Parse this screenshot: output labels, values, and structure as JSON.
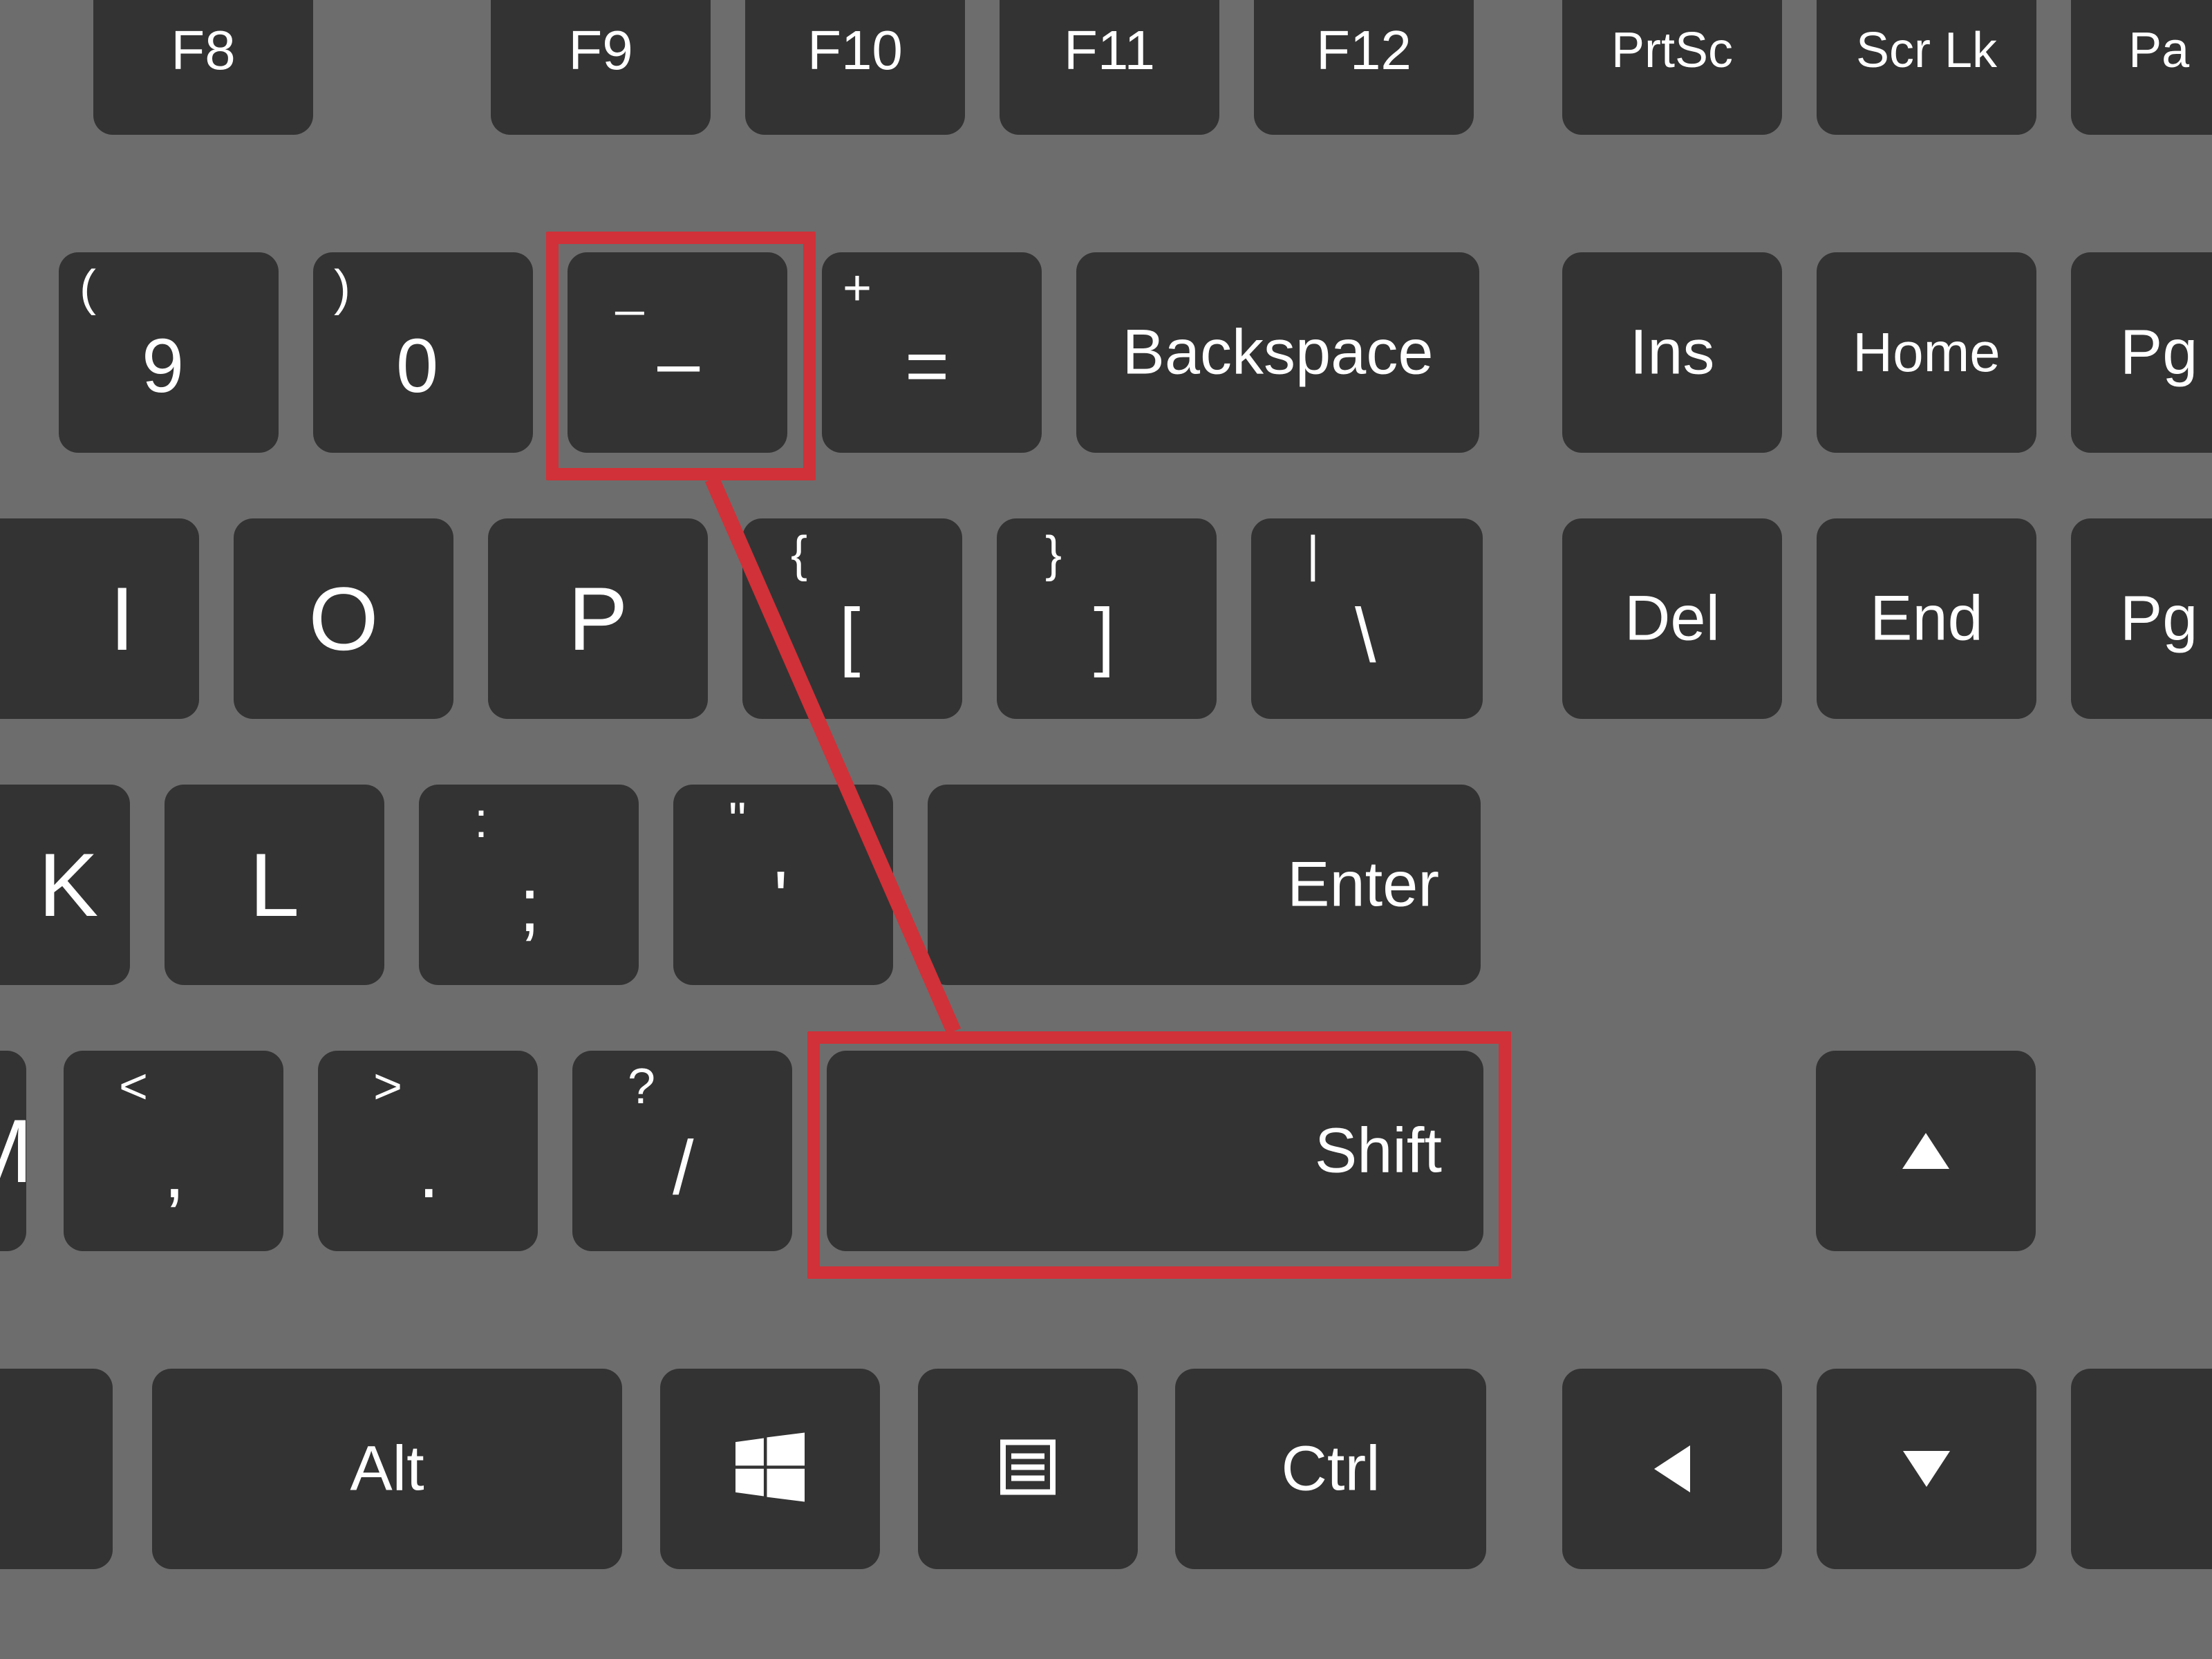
{
  "colors": {
    "background": "#6d6d6d",
    "key": "#333333",
    "key_text": "#ffffff",
    "highlight": "#d13138"
  },
  "rows": {
    "function": [
      {
        "id": "f8",
        "label": "F8"
      },
      {
        "id": "f9",
        "label": "F9"
      },
      {
        "id": "f10",
        "label": "F10"
      },
      {
        "id": "f11",
        "label": "F11"
      },
      {
        "id": "f12",
        "label": "F12"
      },
      {
        "id": "prtsc",
        "label": "PrtSc"
      },
      {
        "id": "scrlk",
        "label": "Scr Lk"
      },
      {
        "id": "pause-partial",
        "label": "Pa"
      }
    ],
    "numbers": [
      {
        "id": "9",
        "upper": "(",
        "lower": "9"
      },
      {
        "id": "0",
        "upper": ")",
        "lower": "0"
      },
      {
        "id": "minus",
        "upper": "_",
        "lower": "–"
      },
      {
        "id": "equals",
        "upper": "+",
        "lower": "="
      },
      {
        "id": "backspace",
        "label": "Backspace"
      },
      {
        "id": "ins",
        "label": "Ins"
      },
      {
        "id": "home",
        "label": "Home"
      },
      {
        "id": "pgup-partial",
        "label": "Pg"
      }
    ],
    "qwerty": [
      {
        "id": "i",
        "letter": "I"
      },
      {
        "id": "o",
        "letter": "O"
      },
      {
        "id": "p",
        "letter": "P"
      },
      {
        "id": "bracket-open",
        "upper": "{",
        "lower": "["
      },
      {
        "id": "bracket-close",
        "upper": "}",
        "lower": "]"
      },
      {
        "id": "backslash",
        "upper": "|",
        "lower": "\\"
      },
      {
        "id": "del",
        "label": "Del"
      },
      {
        "id": "end",
        "label": "End"
      },
      {
        "id": "pgdn-partial",
        "label": "Pg"
      }
    ],
    "home": [
      {
        "id": "k",
        "letter": "K"
      },
      {
        "id": "l",
        "letter": "L"
      },
      {
        "id": "semicolon",
        "upper": ":",
        "lower": ";"
      },
      {
        "id": "quote",
        "upper": "\"",
        "lower": "'"
      },
      {
        "id": "enter",
        "label": "Enter"
      }
    ],
    "shift_row": [
      {
        "id": "m-partial",
        "letter": "M"
      },
      {
        "id": "comma",
        "upper": "<",
        "lower": ","
      },
      {
        "id": "period",
        "upper": ">",
        "lower": "."
      },
      {
        "id": "slash",
        "upper": "?",
        "lower": "/"
      },
      {
        "id": "rshift",
        "label": "Shift"
      },
      {
        "id": "arrow-up",
        "icon": "arrow-up"
      }
    ],
    "bottom": [
      {
        "id": "ralt",
        "label": "Alt"
      },
      {
        "id": "win",
        "icon": "windows"
      },
      {
        "id": "menu",
        "icon": "menu"
      },
      {
        "id": "rctrl",
        "label": "Ctrl"
      },
      {
        "id": "arrow-left",
        "icon": "arrow-left"
      },
      {
        "id": "arrow-down",
        "icon": "arrow-down"
      }
    ]
  },
  "highlights": {
    "minus_key": {
      "target": "minus"
    },
    "shift_key": {
      "target": "rshift"
    }
  }
}
